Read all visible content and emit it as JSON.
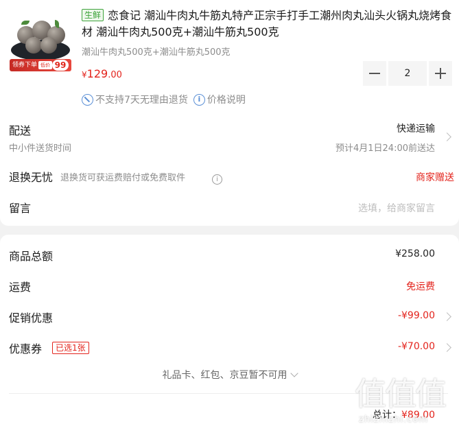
{
  "product": {
    "fresh_tag": "生鲜",
    "title": "恋食记 潮汕牛肉丸牛筋丸特产正宗手打手工潮州肉丸汕头火锅丸烧烤食材 潮汕牛肉丸500克+潮汕牛筋丸500克",
    "spec": "潮汕牛肉丸500克+潮汕牛筋丸500克",
    "price_currency": "¥",
    "price_int": "129",
    "price_dec": ".00",
    "quantity": "2",
    "thumb_banner": "领券下单",
    "thumb_banner_mid": "低价",
    "thumb_price": "99",
    "notice_return": "不支持7天无理由退货",
    "notice_price": "价格说明"
  },
  "delivery": {
    "label": "配送",
    "method": "快递运输",
    "sub": "中小件送货时间",
    "eta": "预计4月1日24:00前送达"
  },
  "returns": {
    "label": "退换无忧",
    "desc": "退换货可获运费赔付或免费取件",
    "right": "商家赠送"
  },
  "message": {
    "label": "留言",
    "placeholder": "选填，给商家留言"
  },
  "summary": {
    "goods_total_label": "商品总额",
    "goods_total": "¥258.00",
    "shipping_label": "运费",
    "shipping": "免运费",
    "promo_label": "促销优惠",
    "promo": "-¥99.00",
    "coupon_label": "优惠券",
    "coupon_tag": "已选1张",
    "coupon": "-¥70.00",
    "gift_line": "礼品卡、红包、京豆暂不可用",
    "total_label": "总计：",
    "total": "¥89.00"
  },
  "watermark": {
    "chars": "值值值",
    "url": "zhizhizhi.com"
  },
  "colors": {
    "accent_red": "#e3231c",
    "fresh_green": "#3ea33b",
    "info_blue": "#5a8fd6"
  }
}
